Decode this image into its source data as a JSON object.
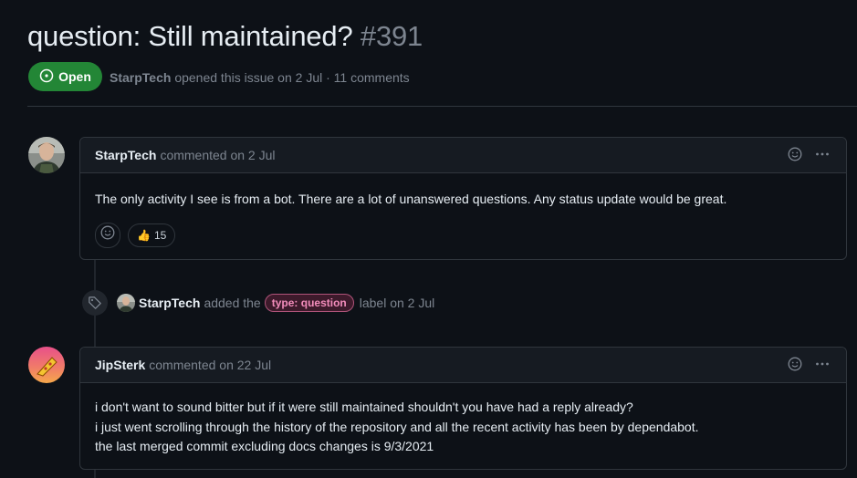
{
  "issue": {
    "title": "question: Still maintained?",
    "number": "#391",
    "state": "Open",
    "author": "StarpTech",
    "meta_text": "opened this issue on 2 Jul · 11 comments"
  },
  "comments": [
    {
      "author": "StarpTech",
      "action": "commented on 2 Jul",
      "body": [
        "The only activity I see is from a bot. There are a lot of unanswered questions. Any status update would be great."
      ],
      "reaction_emoji": "👍",
      "reaction_count": "15"
    },
    {
      "author": "JipSterk",
      "action": "commented on 22 Jul",
      "body": [
        "i don't want to sound bitter but if it were still maintained shouldn't you have had a reply already?",
        "i just went scrolling through the history of the repository and all the recent activity has been by dependabot.",
        "the last merged commit excluding docs changes is 9/3/2021"
      ]
    }
  ],
  "event": {
    "actor": "StarpTech",
    "pre_text": "added the",
    "label": "type: question",
    "post_text": "label on 2 Jul"
  },
  "colors": {
    "open_green": "#238636",
    "label_pink": "#f28cbb",
    "background": "#0d1117"
  },
  "icons": {
    "state": "issue-opened-icon",
    "reaction_add": "smiley-icon",
    "menu": "kebab-icon",
    "event": "tag-icon"
  }
}
